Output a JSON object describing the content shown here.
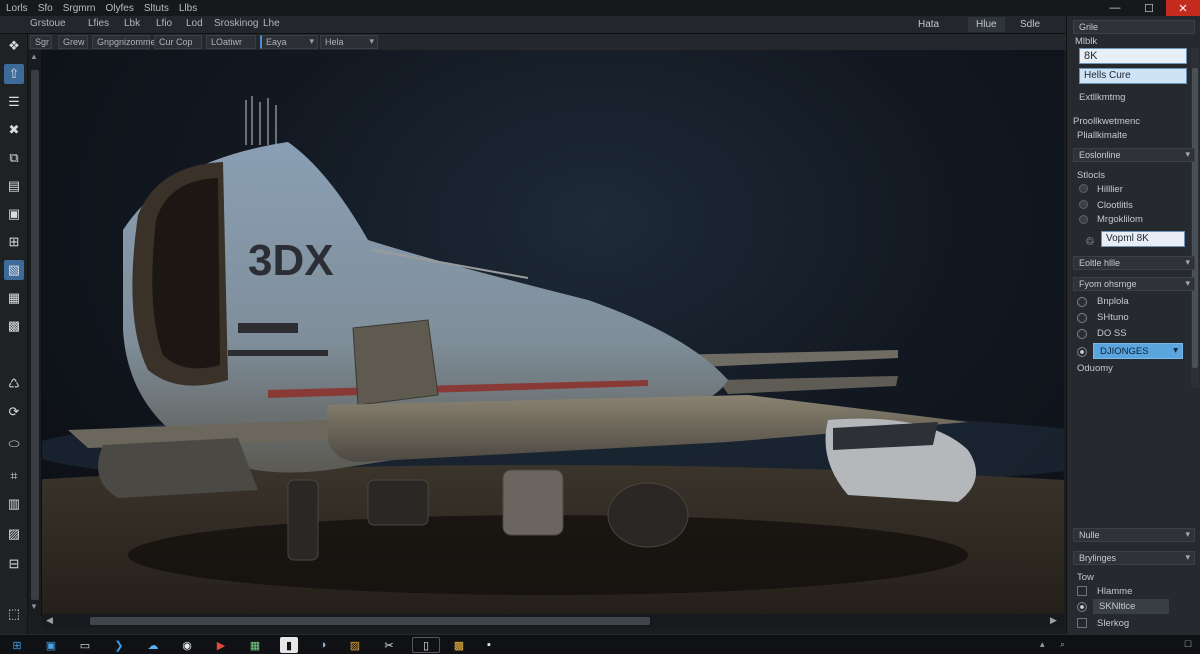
{
  "titlebar": {
    "menu": [
      "Lorls",
      "Sfo",
      "Srgmrn",
      "Olyfes",
      "Sltuts",
      "Llbs"
    ],
    "controls": {
      "minimize": "—",
      "maximize": "☐",
      "close": "✕"
    }
  },
  "menubar": {
    "items": [
      "Grstoue",
      "Lfies",
      "Lbk",
      "Lfio",
      "Lod",
      "Sroskinog",
      "Lhe"
    ],
    "modes": [
      "Hata",
      "Hlue",
      "Sdle"
    ]
  },
  "toolbar": {
    "buttons": [
      "Sgr",
      "Grew",
      "Gnpgnizomme",
      "Cur Cop",
      "LOatiwr",
      "Eaya",
      "Hela"
    ]
  },
  "tools": [
    "❖",
    "⇧",
    "☰",
    "✖",
    "⧉",
    "▤",
    "▣",
    "⊞",
    "▧",
    "▦",
    "▩",
    "♺",
    "⟳",
    "⬭",
    "⌗",
    "▥",
    "▨",
    "⊟",
    "⬚"
  ],
  "viewport": {
    "model_text": "3DX",
    "accent": "#b8c9d8"
  },
  "panel": {
    "header": "Grile",
    "field_label": "Mlblk",
    "field_value": "8K",
    "field_value2": "Hells Cure",
    "sub_label": "Extllkmtmg",
    "section1_title": "Proollkwetmenc",
    "section1_sub": "Pliallkimalte",
    "dropdown1": "Eoslonline",
    "section2_title": "Stlocls",
    "checks": [
      "Hilllier",
      "Clootlitls",
      "Mrgoklilom"
    ],
    "badge_icon": "♲",
    "badge_field": "Vopml 8K",
    "dropdown2": "Eoltle hllle",
    "dropdown3": "Fyom ohsrnge",
    "radios": [
      "Bnplola",
      "SHtuno",
      "DO SS",
      "DJIONGES"
    ],
    "radio_footer": "Oduomy",
    "dropdown4": "Nulle",
    "dropdown5": "Brylinges",
    "bottom_title": "Tow",
    "bottom_items": [
      "Hlamme",
      "SKNltlce",
      "Slerkog"
    ]
  },
  "taskbar": {
    "icons": [
      "⊞",
      "▣",
      "▭",
      "❯",
      "☁",
      "◉",
      "▶",
      "▦",
      "▮",
      "◑",
      "▨",
      "✂",
      "▯",
      "▩",
      "▪"
    ],
    "tray": [
      "▴",
      "⌕",
      "☐"
    ]
  }
}
